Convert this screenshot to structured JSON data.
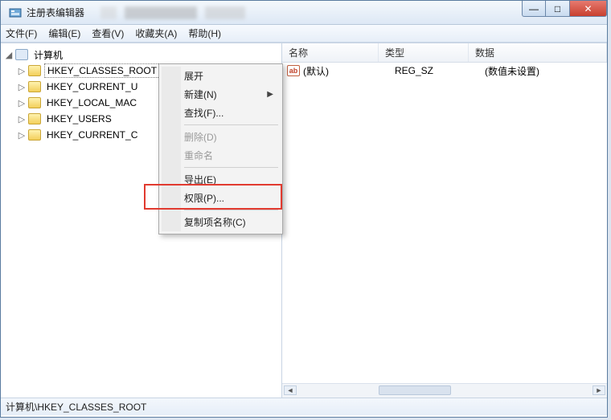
{
  "window": {
    "title": "注册表编辑器"
  },
  "winbuttons": {
    "min": "—",
    "max": "□",
    "close": "✕"
  },
  "menubar": [
    "文件(F)",
    "编辑(E)",
    "查看(V)",
    "收藏夹(A)",
    "帮助(H)"
  ],
  "tree": {
    "root": "计算机",
    "keys": [
      "HKEY_CLASSES_ROOT",
      "HKEY_CURRENT_U",
      "HKEY_LOCAL_MAC",
      "HKEY_USERS",
      "HKEY_CURRENT_C"
    ]
  },
  "list": {
    "headers": {
      "name": "名称",
      "type": "类型",
      "data": "数据"
    },
    "rows": [
      {
        "icon": "ab",
        "name": "(默认)",
        "type": "REG_SZ",
        "data": "(数值未设置)"
      }
    ]
  },
  "context_menu": {
    "expand": "展开",
    "new": "新建(N)",
    "find": "查找(F)...",
    "delete": "删除(D)",
    "rename": "重命名",
    "export": "导出(E)",
    "permissions": "权限(P)...",
    "copykey": "复制项名称(C)"
  },
  "statusbar": "计算机\\HKEY_CLASSES_ROOT"
}
